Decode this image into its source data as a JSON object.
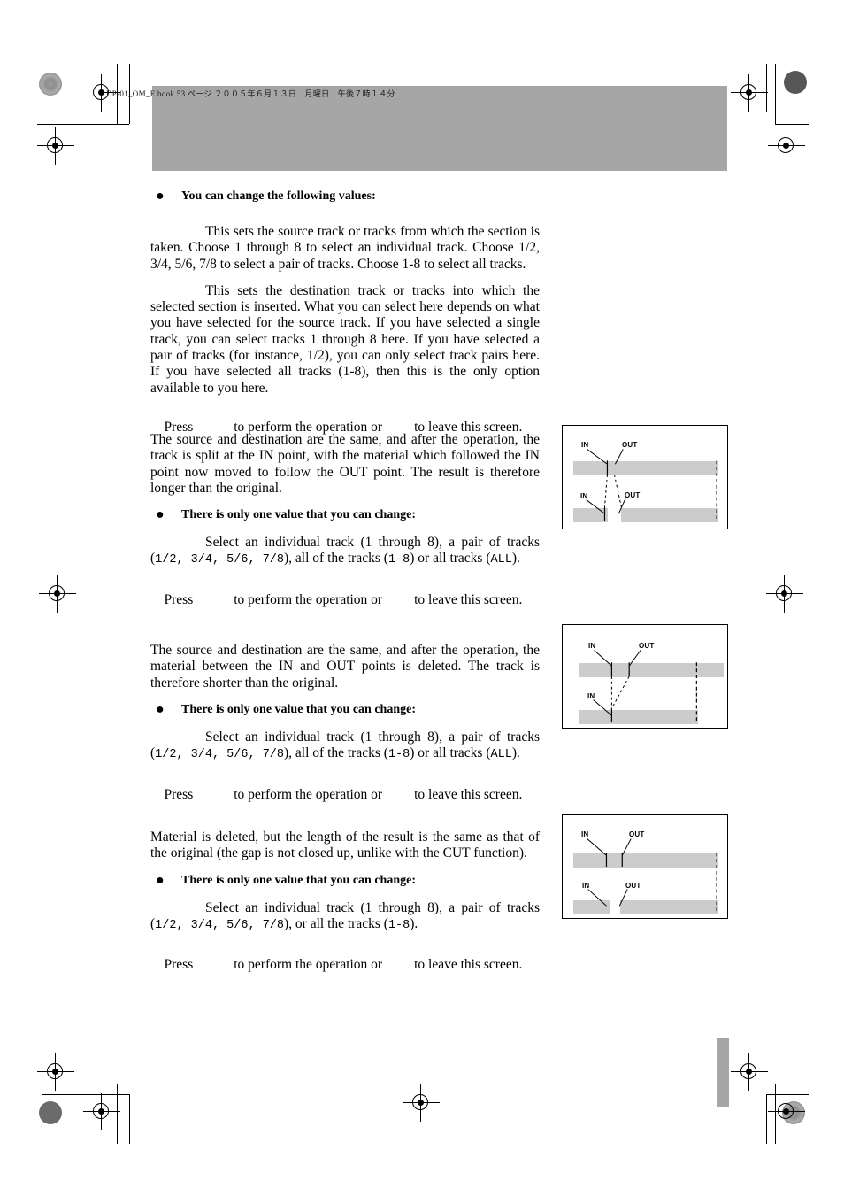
{
  "page": {
    "header_caption": "DP-01_OM_E.book  53 ページ  ２００５年６月１３日　月曜日　午後７時１４分",
    "band_color": "#a6a6a6",
    "track_color": "#cccccc"
  },
  "sections": [
    {
      "id": "copy-paste",
      "bullet_heading": "You can change the following values:",
      "paragraphs": [
        "This sets the source track or tracks from which the section is taken. Choose 1 through 8 to select an individual track. Choose 1/2, 3/4, 5/6, 7/8 to select a pair of tracks. Choose 1-8 to select all tracks.",
        "This sets the destination track or tracks into which the selected section is inserted. What you can select here depends on what you have selected for the source track. If you have selected a single track, you can select tracks 1 through 8 here. If you have selected a pair of tracks (for instance, 1/2), you can only select track pairs here. If you have selected all tracks (1-8), then this is the only option available to you here."
      ],
      "press": {
        "prefix": "Press",
        "middle": "to perform the operation or",
        "suffix": "to leave this screen."
      }
    },
    {
      "id": "open",
      "intro": "The source and destination are the same, and after the operation, the track is split at the IN point, with the material which followed the IN point now moved to follow the OUT point. The result is therefore longer than the original.",
      "bullet_heading": "There is only one value that you can change:",
      "detail_plain_1": "Select an individual track (1 through 8), a pair of tracks (",
      "detail_mono_1": "1/2, 3/4, 5/6, 7/8",
      "detail_plain_2": "), all of the tracks (",
      "detail_mono_2": "1-8",
      "detail_plain_3": ") or all tracks (",
      "detail_mono_3": "ALL",
      "detail_plain_4": ").",
      "press": {
        "prefix": "Press",
        "middle": "to perform the operation or",
        "suffix": "to leave this screen."
      }
    },
    {
      "id": "cut",
      "intro": "The source and destination are the same, and after the operation, the material between the IN and OUT points is deleted. The track is therefore shorter than the original.",
      "bullet_heading": "There is only one value that you can change:",
      "detail_plain_1": "Select an individual track (1 through 8), a pair of tracks (",
      "detail_mono_1": "1/2, 3/4, 5/6, 7/8",
      "detail_plain_2": "), all of the tracks (",
      "detail_mono_2": "1-8",
      "detail_plain_3": ") or all tracks (",
      "detail_mono_3": "ALL",
      "detail_plain_4": ").",
      "press": {
        "prefix": "Press",
        "middle": "to perform the operation or",
        "suffix": "to leave this screen."
      }
    },
    {
      "id": "silence",
      "intro": "Material is deleted, but the length of the result is the same as that of the original (the gap is not closed up, unlike with the CUT function).",
      "bullet_heading": "There is only one value that you can change:",
      "detail_plain_1": "Select an individual track (1 through 8), a pair of tracks (",
      "detail_mono_1": "1/2, 3/4, 5/6, 7/8",
      "detail_plain_2": "), or all the tracks (",
      "detail_mono_2": "1-8",
      "detail_plain_3": ").",
      "press": {
        "prefix": "Press",
        "middle": "to perform the operation or",
        "suffix": "to leave this screen."
      }
    }
  ],
  "diagrams": [
    {
      "id": "open-diagram",
      "top_labels": [
        "IN",
        "OUT"
      ],
      "bottom_labels": [
        "IN",
        "OUT"
      ]
    },
    {
      "id": "cut-diagram",
      "top_labels": [
        "IN",
        "OUT"
      ],
      "bottom_labels": [
        "IN"
      ]
    },
    {
      "id": "silence-diagram",
      "top_labels": [
        "IN",
        "OUT"
      ],
      "bottom_labels": [
        "IN",
        "OUT"
      ]
    }
  ]
}
